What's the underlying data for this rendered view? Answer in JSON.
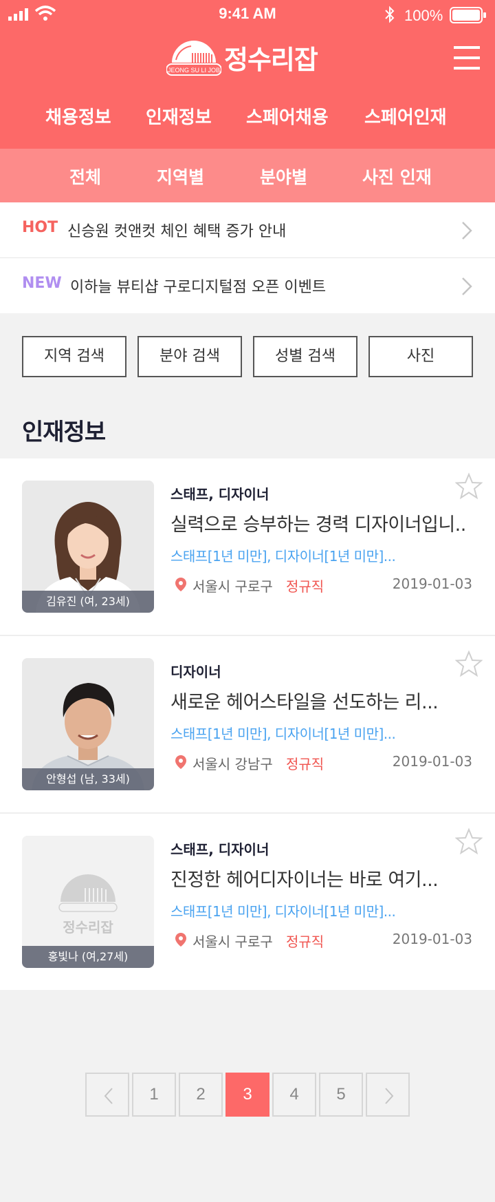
{
  "status_bar": {
    "time": "9:41 AM",
    "battery": "100%"
  },
  "header": {
    "logo_text": "정수리잡",
    "logo_subtext": "JEONG SU LI JOB",
    "main_nav": [
      "채용정보",
      "인재정보",
      "스페어채용",
      "스페어인재"
    ],
    "sub_nav": [
      "전체",
      "지역별",
      "분야별",
      "사진 인재"
    ]
  },
  "notices": [
    {
      "tag": "HOT",
      "tag_color": "#f5635f",
      "text": "신승원 컷앤컷 체인 혜택 증가 안내"
    },
    {
      "tag": "NEW",
      "tag_color": "#b08ef0",
      "text": "이하늘 뷰티샵 구로디지털점 오픈 이벤트"
    }
  ],
  "filters": [
    "지역 검색",
    "분야 검색",
    "성별 검색",
    "사진"
  ],
  "section_title": "인재정보",
  "cards": [
    {
      "name_caption": "김유진 (여, 23세)",
      "field": "스태프, 디자이너",
      "title": "실력으로 승부하는 경력 디자이너입니...",
      "career": "스태프[1년 미만], 디자이너[1년 미만]...",
      "location": "서울시 구로구",
      "employment_type": "정규직",
      "date": "2019-01-03",
      "photo": "woman-portrait"
    },
    {
      "name_caption": "안형섭 (남, 33세)",
      "field": "디자이너",
      "title": "새로운 헤어스타일을 선도하는 리...",
      "career": "스태프[1년 미만], 디자이너[1년 미만]...",
      "location": "서울시 강남구",
      "employment_type": "정규직",
      "date": "2019-01-03",
      "photo": "man-portrait"
    },
    {
      "name_caption": "홍빛나 (여,27세)",
      "field": "스태프, 디자이너",
      "title": "진정한 헤어디자이너는 바로 여기...",
      "career": "스태프[1년 미만], 디자이너[1년 미만]...",
      "location": "서울시 구로구",
      "employment_type": "정규직",
      "date": "2019-01-03",
      "photo": "logo-placeholder",
      "placeholder_logo_text": "정수리잡"
    }
  ],
  "pagination": {
    "pages": [
      "1",
      "2",
      "3",
      "4",
      "5"
    ],
    "current": "3"
  },
  "colors": {
    "brand": "#fd6968",
    "brand_light": "#fd8b8a",
    "link": "#4aa3f0",
    "accent_text": "#f0544f"
  }
}
